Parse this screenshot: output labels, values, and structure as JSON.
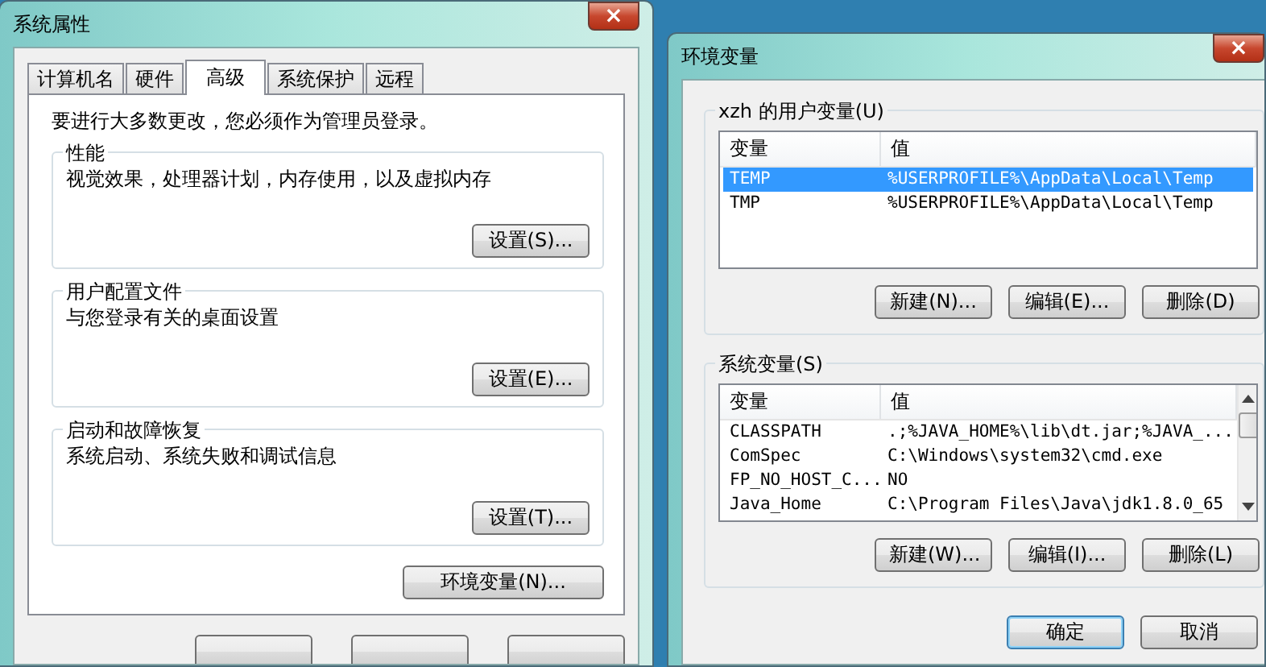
{
  "system_properties": {
    "title": "系统属性",
    "close": "×",
    "tabs": [
      {
        "label": "计算机名",
        "selected": false
      },
      {
        "label": "硬件",
        "selected": false
      },
      {
        "label": "高级",
        "selected": true
      },
      {
        "label": "系统保护",
        "selected": false
      },
      {
        "label": "远程",
        "selected": false
      }
    ],
    "notice": "要进行大多数更改，您必须作为管理员登录。",
    "groups": [
      {
        "title": "性能",
        "description": "视觉效果，处理器计划，内存使用，以及虚拟内存",
        "button": "设置(S)..."
      },
      {
        "title": "用户配置文件",
        "description": "与您登录有关的桌面设置",
        "button": "设置(E)..."
      },
      {
        "title": "启动和故障恢复",
        "description": "系统启动、系统失败和调试信息",
        "button": "设置(T)..."
      }
    ],
    "env_button": "环境变量(N)..."
  },
  "environment_variables": {
    "title": "环境变量",
    "close": "×",
    "user_vars": {
      "title": "xzh 的用户变量(U)",
      "columns": [
        "变量",
        "值"
      ],
      "rows": [
        {
          "name": "TEMP",
          "value": "%USERPROFILE%\\AppData\\Local\\Temp",
          "selected": true
        },
        {
          "name": "TMP",
          "value": "%USERPROFILE%\\AppData\\Local\\Temp",
          "selected": false
        }
      ],
      "buttons": [
        "新建(N)...",
        "编辑(E)...",
        "删除(D)"
      ]
    },
    "system_vars": {
      "title": "系统变量(S)",
      "columns": [
        "变量",
        "值"
      ],
      "rows": [
        {
          "name": "CLASSPATH",
          "value": ".;%JAVA_HOME%\\lib\\dt.jar;%JAVA_...",
          "selected": false
        },
        {
          "name": "ComSpec",
          "value": "C:\\Windows\\system32\\cmd.exe",
          "selected": false
        },
        {
          "name": "FP_NO_HOST_C...",
          "value": "NO",
          "selected": false
        },
        {
          "name": "Java_Home",
          "value": "C:\\Program Files\\Java\\jdk1.8.0_65",
          "selected": false
        }
      ],
      "buttons": [
        "新建(W)...",
        "编辑(I)...",
        "删除(L)"
      ]
    },
    "buttons": [
      {
        "label": "确定",
        "default": true
      },
      {
        "label": "取消",
        "default": false
      }
    ]
  }
}
